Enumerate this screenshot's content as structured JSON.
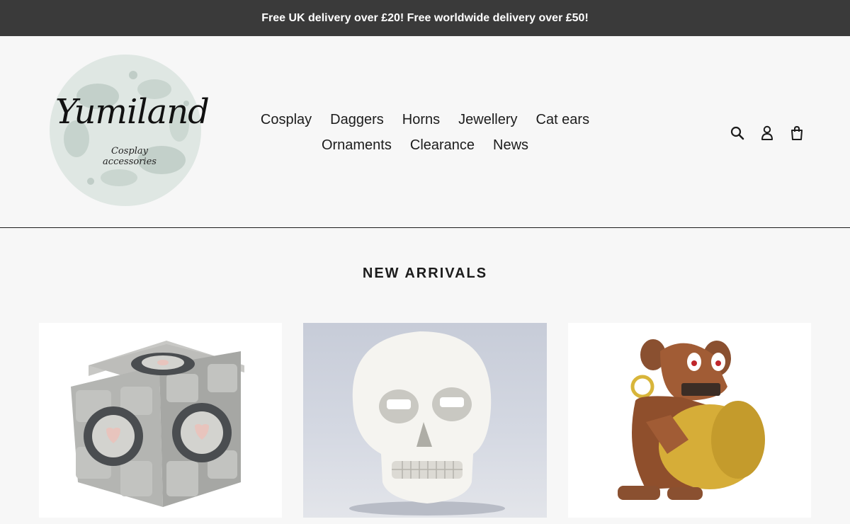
{
  "announcement": {
    "text": "Free UK delivery over £20! Free worldwide delivery over £50!"
  },
  "logo": {
    "name": "Yumiland",
    "tagline": "Cosplay accessories"
  },
  "nav": {
    "row1": [
      "Cosplay",
      "Daggers",
      "Horns",
      "Jewellery",
      "Cat ears"
    ],
    "row2": [
      "Ornaments",
      "Clearance",
      "News"
    ]
  },
  "header_icons": [
    "search-icon",
    "account-icon",
    "cart-icon"
  ],
  "section": {
    "title": "NEW ARRIVALS"
  },
  "products": [
    {
      "image": "companion-cube-image"
    },
    {
      "image": "skull-image"
    },
    {
      "image": "cymbal-monkey-image"
    }
  ],
  "colors": {
    "announcement_bg": "#3a3a3a",
    "page_bg": "#f7f7f7",
    "text": "#1c1c1c"
  }
}
